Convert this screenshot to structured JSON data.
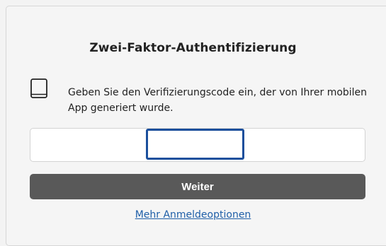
{
  "dialog": {
    "title": "Zwei-Faktor-Authentifizierung",
    "description": "Geben Sie den Verifizierungscode ein, der von Ihrer mobilen App generiert wurde.",
    "device_icon": "tablet-icon",
    "code_input": {
      "value": "",
      "placeholder": ""
    },
    "continue_label": "Weiter",
    "more_options_label": "Mehr Anmeldeoptionen"
  },
  "colors": {
    "button_bg": "#595959",
    "link": "#1f5fa8",
    "focus_border": "#1b4f9c"
  }
}
